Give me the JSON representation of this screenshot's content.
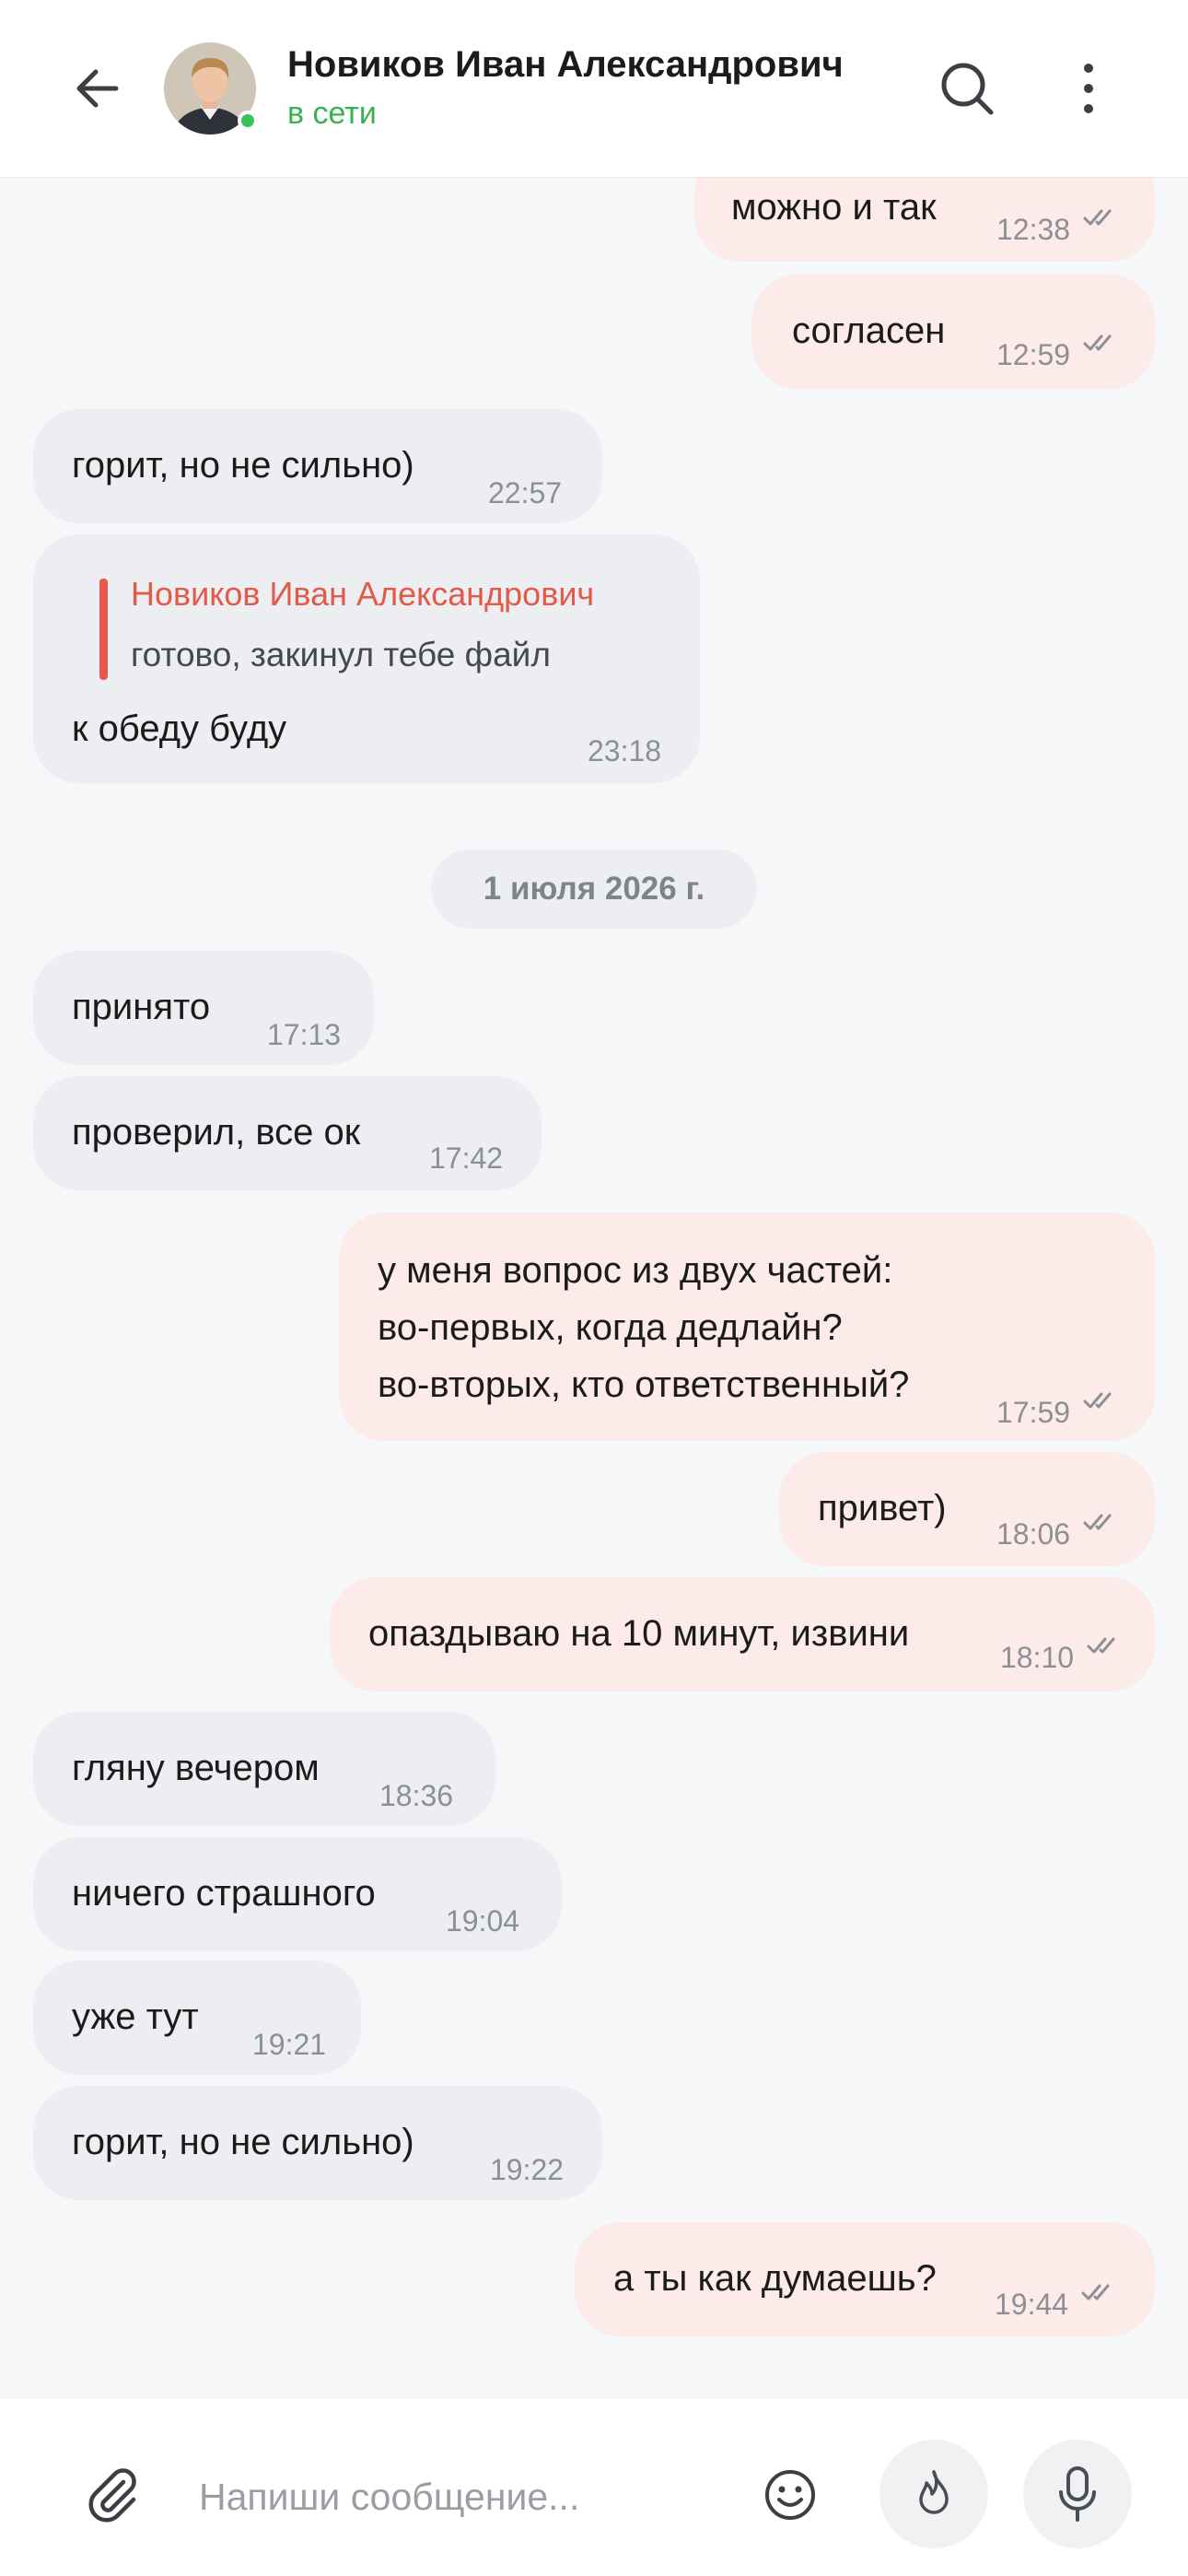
{
  "header": {
    "contact_name": "Новиков Иван Александрович",
    "status": "в сети"
  },
  "date_separator": "1 июля 2026 г.",
  "messages": [
    {
      "direction": "out",
      "text": "можно и так",
      "time": "12:38",
      "read": true
    },
    {
      "direction": "out",
      "text": "согласен",
      "time": "12:59",
      "read": true
    },
    {
      "direction": "in",
      "text": "горит, но не сильно)",
      "time": "22:57"
    },
    {
      "direction": "in",
      "reply_to": {
        "author": "Новиков Иван Александрович",
        "text": "готово, закинул тебе файл"
      },
      "text": "к обеду буду",
      "time": "23:18"
    },
    {
      "direction": "in",
      "text": "принято",
      "time": "17:13"
    },
    {
      "direction": "in",
      "text": "проверил, все ок",
      "time": "17:42"
    },
    {
      "direction": "out",
      "lines": [
        "у меня вопрос из двух частей:",
        "во-первых, когда дедлайн?",
        "во-вторых, кто ответственный?"
      ],
      "time": "17:59",
      "read": true
    },
    {
      "direction": "out",
      "text": "привет)",
      "time": "18:06",
      "read": true
    },
    {
      "direction": "out",
      "text": "опаздываю на 10 минут, извини",
      "time": "18:10",
      "read": true
    },
    {
      "direction": "in",
      "text": "гляну вечером",
      "time": "18:36"
    },
    {
      "direction": "in",
      "text": "ничего страшного",
      "time": "19:04"
    },
    {
      "direction": "in",
      "text": "уже тут",
      "time": "19:21"
    },
    {
      "direction": "in",
      "text": "горит, но не сильно)",
      "time": "19:22"
    },
    {
      "direction": "out",
      "text": "а ты как думаешь?",
      "time": "19:44",
      "read": true
    }
  ],
  "composer": {
    "placeholder": "Напиши сообщение..."
  },
  "icons": {
    "back": "arrow-left-icon",
    "search": "search-icon",
    "menu": "more-vertical-icon",
    "attach": "paperclip-icon",
    "emoji": "smile-icon",
    "fire": "flame-icon",
    "mic": "microphone-icon",
    "read": "double-check-icon"
  },
  "colors": {
    "incoming_bubble": "#eceef1",
    "outgoing_bubble": "#fdebea",
    "online": "#39c15b",
    "reply_accent": "#e8594b"
  }
}
